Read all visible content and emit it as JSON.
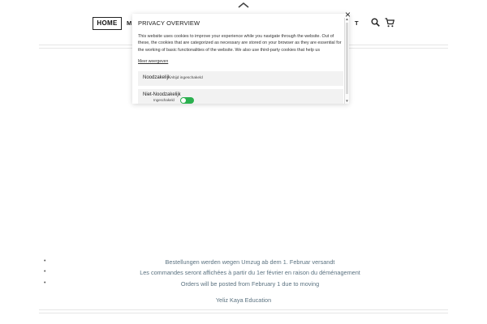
{
  "nav": {
    "home_label": "HOME",
    "partial_left": "M",
    "partial_right": "T"
  },
  "icons": {
    "top": "chevron-up-icon",
    "search": "search-icon",
    "cart": "cart-icon",
    "close": "close-icon"
  },
  "modal": {
    "title": "PRIVACY OVERVIEW",
    "body": "This website uses cookies to improve your experience while you navigate through the website. Out of these, the cookies that are categorized as necessary are stored on your browser as they are essential for the working of basic functionalities of the website. We also use third-party cookies that help us",
    "show_more": "Meer weergeven",
    "close_glyph": "×",
    "rows": [
      {
        "label": "Noodzakelijk",
        "status": "Altijd ingeschakeld"
      },
      {
        "label": "Niet-Noodzakelijk",
        "status": "Ingeschakeld",
        "toggle_on": true
      }
    ],
    "toggle_color": "#2bb04f"
  },
  "notices": [
    "Bestellungen werden wegen Umzug ab dem 1. Februar versandt",
    "Les commandes seront affichées à partir du 1er février en raison du déménagement",
    "Orders will be posted from February 1 due to moving"
  ],
  "bullet": "•",
  "footer": {
    "credit": "Yeliz Kaya Education"
  }
}
